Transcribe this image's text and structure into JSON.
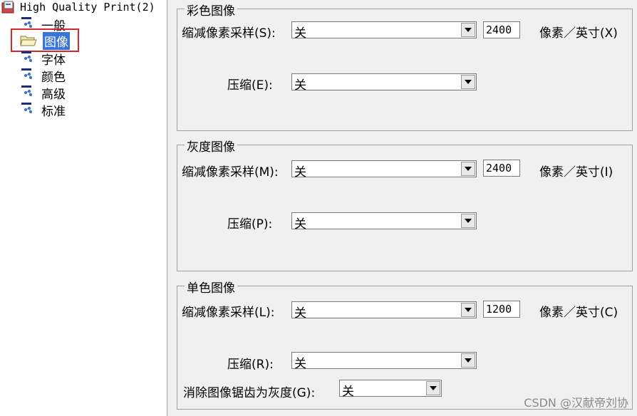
{
  "tree": {
    "root_label": "High Quality Print(2)",
    "items": [
      {
        "label": "一般"
      },
      {
        "label": "图像",
        "selected": true
      },
      {
        "label": "字体"
      },
      {
        "label": "颜色"
      },
      {
        "label": "高级"
      },
      {
        "label": "标准"
      }
    ]
  },
  "color_images": {
    "title": "彩色图像",
    "downsample_label": "缩减像素采样(S):",
    "downsample_value": "关",
    "resolution_value": "2400",
    "unit_label": "像素／英寸(X)",
    "compression_label": "压缩(E):",
    "compression_value": "关"
  },
  "gray_images": {
    "title": "灰度图像",
    "downsample_label": "缩减像素采样(M):",
    "downsample_value": "关",
    "resolution_value": "2400",
    "unit_label": "像素／英寸(I)",
    "compression_label": "压缩(P):",
    "compression_value": "关"
  },
  "mono_images": {
    "title": "单色图像",
    "downsample_label": "缩减像素采样(L):",
    "downsample_value": "关",
    "resolution_value": "1200",
    "unit_label": "像素／英寸(C)",
    "compression_label": "压缩(R):",
    "compression_value": "关",
    "antialias_label": "消除图像锯齿为灰度(G):",
    "antialias_value": "关"
  },
  "watermark": "CSDN @汉献帝刘协",
  "colors": {
    "selection": "#3875d7",
    "highlight_frame": "#d9262b"
  }
}
